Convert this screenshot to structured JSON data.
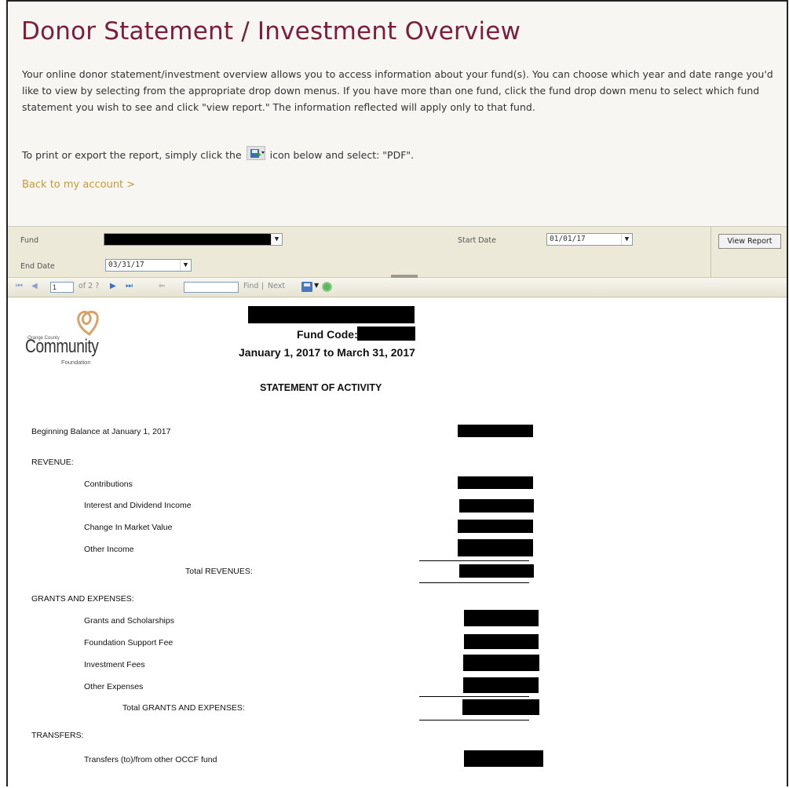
{
  "page": {
    "title": "Donor Statement / Investment Overview",
    "description": "Your online donor statement/investment overview allows you to access information about your fund(s). You can choose which year and date range you'd like to view by selecting from the appropriate drop down menus. If you have more than one fund, click the fund drop down menu to select which fund statement you wish to see and click \"view report.\" The information reflected will apply only to that fund.",
    "print_before": "To print or export the report, simply click the",
    "print_after": "icon below and select: \"PDF\".",
    "back_link": "Back to my account >"
  },
  "params": {
    "fund_label": "Fund",
    "start_date_label": "Start Date",
    "start_date_value": "01/01/17",
    "end_date_label": "End Date",
    "end_date_value": "03/31/17",
    "view_report": "View Report"
  },
  "toolbar": {
    "first": "⏮",
    "prev": "◀",
    "page": "1",
    "of_pages": "of 2 ?",
    "next": "▶",
    "last": "⏭",
    "back": "⇦",
    "find": "Find",
    "separator": "|",
    "next_find": "Next"
  },
  "report": {
    "logo_small": "Orange County",
    "logo_main": "Community",
    "logo_sub": "Foundation",
    "fund_code_label": "Fund Code:",
    "date_range": "January 1, 2017 to March 31, 2017",
    "section_title": "STATEMENT OF ACTIVITY",
    "beginning_balance": "Beginning Balance at January 1, 2017",
    "revenue_header": "REVENUE:",
    "contributions": "Contributions",
    "interest_dividend": "Interest and Dividend Income",
    "market_value": "Change In Market Value",
    "other_income": "Other Income",
    "total_revenues": "Total REVENUES:",
    "grants_header": "GRANTS AND EXPENSES:",
    "grants_scholarships": "Grants and Scholarships",
    "support_fee": "Foundation Support Fee",
    "investment_fees": "Investment Fees",
    "other_expenses": "Other Expenses",
    "total_grants": "Total GRANTS AND EXPENSES:",
    "transfers_header": "TRANSFERS:",
    "transfers_line": "Transfers (to)/from other OCCF fund"
  },
  "colors": {
    "title": "#7b1d3c",
    "link": "#c69a3a",
    "param_bar": "#ece9d8"
  }
}
